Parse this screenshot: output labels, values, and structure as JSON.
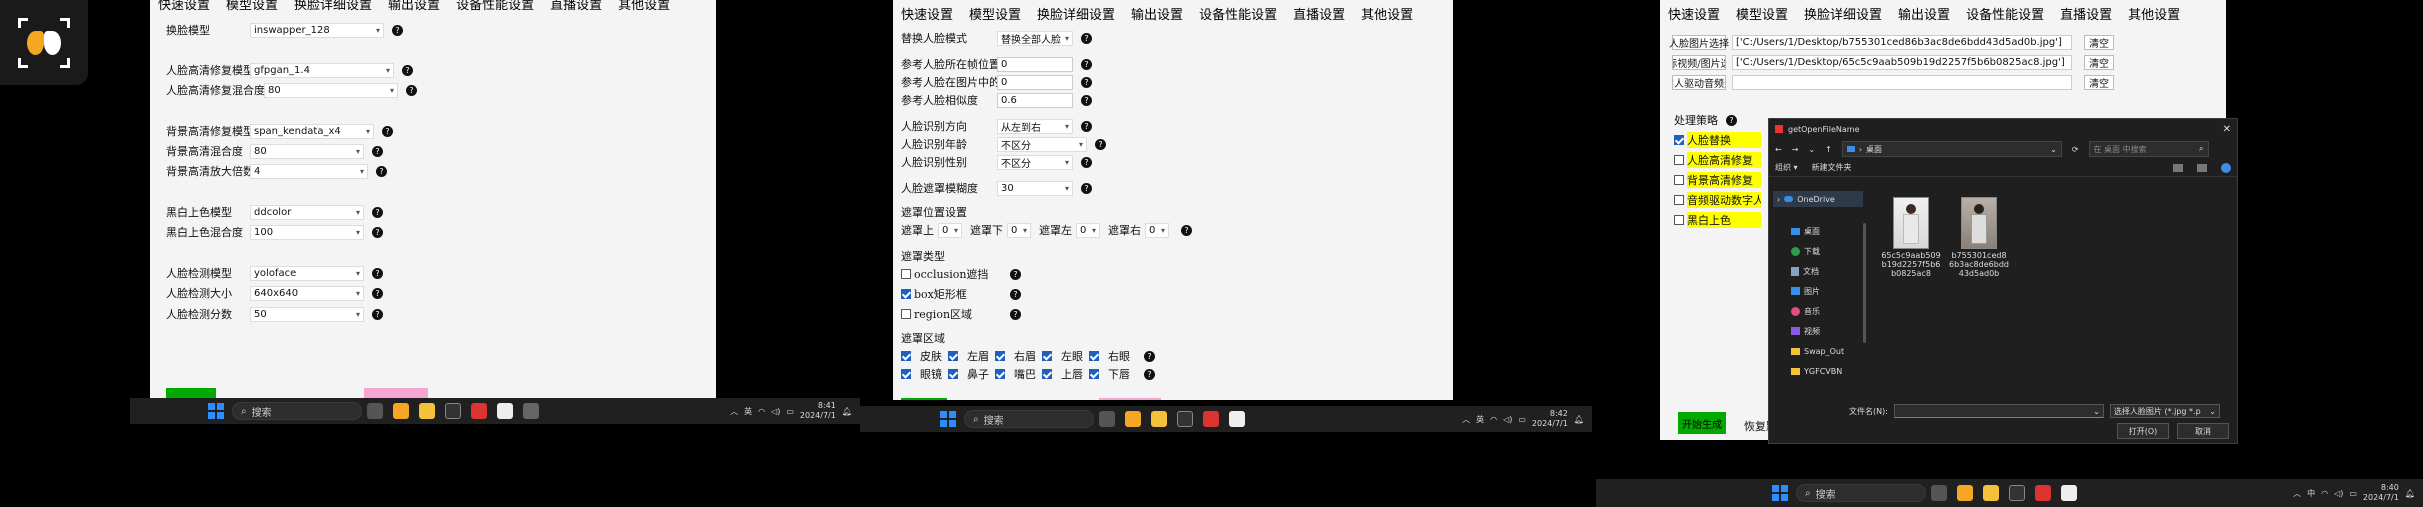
{
  "logo": {
    "icon": "mask-logo-icon",
    "bg": "#1a1a1a",
    "accent": "#f5a623"
  },
  "panel1": {
    "tabs": [
      "快速设置",
      "模型设置",
      "换脸详细设置",
      "输出设置",
      "设备性能设置",
      "直播设置",
      "其他设置"
    ],
    "rows": [
      {
        "label": "换脸模型",
        "value": "inswapper_128"
      },
      {
        "label": "人脸高清修复模型",
        "value": "gfpgan_1.4"
      },
      {
        "label": "人脸高清修复混合度",
        "value": "80"
      },
      {
        "label": "背景高清修复模型",
        "value": "span_kendata_x4"
      },
      {
        "label": "背景高清混合度",
        "value": "80"
      },
      {
        "label": "背景高清放大倍数",
        "value": "4"
      },
      {
        "label": "黑白上色模型",
        "value": "ddcolor"
      },
      {
        "label": "黑白上色混合度",
        "value": "100"
      },
      {
        "label": "人脸检测模型",
        "value": "yoloface"
      },
      {
        "label": "人脸检测大小",
        "value": "640x640"
      },
      {
        "label": "人脸检测分数",
        "value": "50"
      }
    ]
  },
  "panel2": {
    "tabs": [
      "快速设置",
      "模型设置",
      "换脸详细设置",
      "输出设置",
      "设备性能设置",
      "直播设置",
      "其他设置"
    ],
    "mode_label": "替换人脸模式",
    "mode_value": "替换全部人脸",
    "ref_rows": [
      {
        "label": "参考人脸所在帧位置",
        "value": "0"
      },
      {
        "label": "参考人脸在图片中的",
        "value": "0"
      },
      {
        "label": "参考人脸相似度",
        "value": "0.6"
      }
    ],
    "detect_rows": [
      {
        "label": "人脸识别方向",
        "value": "从左到右"
      },
      {
        "label": "人脸识别年龄",
        "value": "不区分"
      },
      {
        "label": "人脸识别性别",
        "value": "不区分"
      }
    ],
    "blur_label": "人脸遮罩模糊度",
    "blur_value": "30",
    "mask_pos_title": "遮罩位置设置",
    "mask_pos": [
      {
        "label": "遮罩上",
        "value": "0"
      },
      {
        "label": "遮罩下",
        "value": "0"
      },
      {
        "label": "遮罩左",
        "value": "0"
      },
      {
        "label": "遮罩右",
        "value": "0"
      }
    ],
    "mask_type_title": "遮罩类型",
    "mask_types": [
      {
        "label": "occlusion遮挡",
        "on": false
      },
      {
        "label": "box矩形框",
        "on": true
      },
      {
        "label": "region区域",
        "on": false
      }
    ],
    "mask_region_title": "遮罩区域",
    "region_row1": [
      "皮肤",
      "左眉",
      "右眉",
      "左眼",
      "右眼"
    ],
    "region_row2": [
      "眼镜",
      "鼻子",
      "嘴巴",
      "上唇",
      "下唇"
    ]
  },
  "panel3": {
    "tabs": [
      "快速设置",
      "模型设置",
      "换脸详细设置",
      "输出设置",
      "设备性能设置",
      "直播设置",
      "其他设置"
    ],
    "path_rows": [
      {
        "label": "人脸图片选择",
        "value": "['C:/Users/1/Desktop/b755301ced86b3ac8de6bdd43d5ad0b.jpg']",
        "btn": "清空"
      },
      {
        "label": "目标视频/图片选择",
        "value": "['C:/Users/1/Desktop/65c5c9aab509b19d2257f5b6b0825ac8.jpg']",
        "btn": "清空"
      },
      {
        "label": "数字人驱动音频选择",
        "value": "",
        "btn": "清空"
      }
    ],
    "strategy_title": "处理策略",
    "strategies": [
      "人脸替换",
      "人脸高清修复",
      "背景高清修复",
      "音频驱动数字人嘴",
      "黑白上色"
    ],
    "start_btn": "开始生成",
    "restore_btn": "恢复默"
  },
  "dialog": {
    "title": "getOpenFileName",
    "path": "桌面",
    "search_placeholder": "在 桌面 中搜索",
    "organize": "组织 ▾",
    "new_folder": "新建文件夹",
    "sidebar": [
      "OneDrive",
      "桌面",
      "下载",
      "文档",
      "图片",
      "音乐",
      "视频",
      "Swap_Out",
      "YGFCVBN"
    ],
    "files": [
      {
        "name": "65c5c9aab509b19d2257f5b6b0825ac8"
      },
      {
        "name": "b755301ced86b3ac8de6bdd43d5ad0b"
      }
    ],
    "filename_label": "文件名(N):",
    "filter": "选择人脸图片 (*.jpg *.p",
    "open_btn": "打开(O)",
    "cancel_btn": "取消"
  },
  "taskbars": [
    {
      "search": "搜索",
      "lang": "英",
      "time": "8:41",
      "date": "2024/7/1"
    },
    {
      "search": "搜索",
      "lang": "英",
      "time": "8:42",
      "date": "2024/7/1"
    },
    {
      "search": "搜索",
      "lang": "中",
      "time": "8:40",
      "date": "2024/7/1"
    }
  ]
}
